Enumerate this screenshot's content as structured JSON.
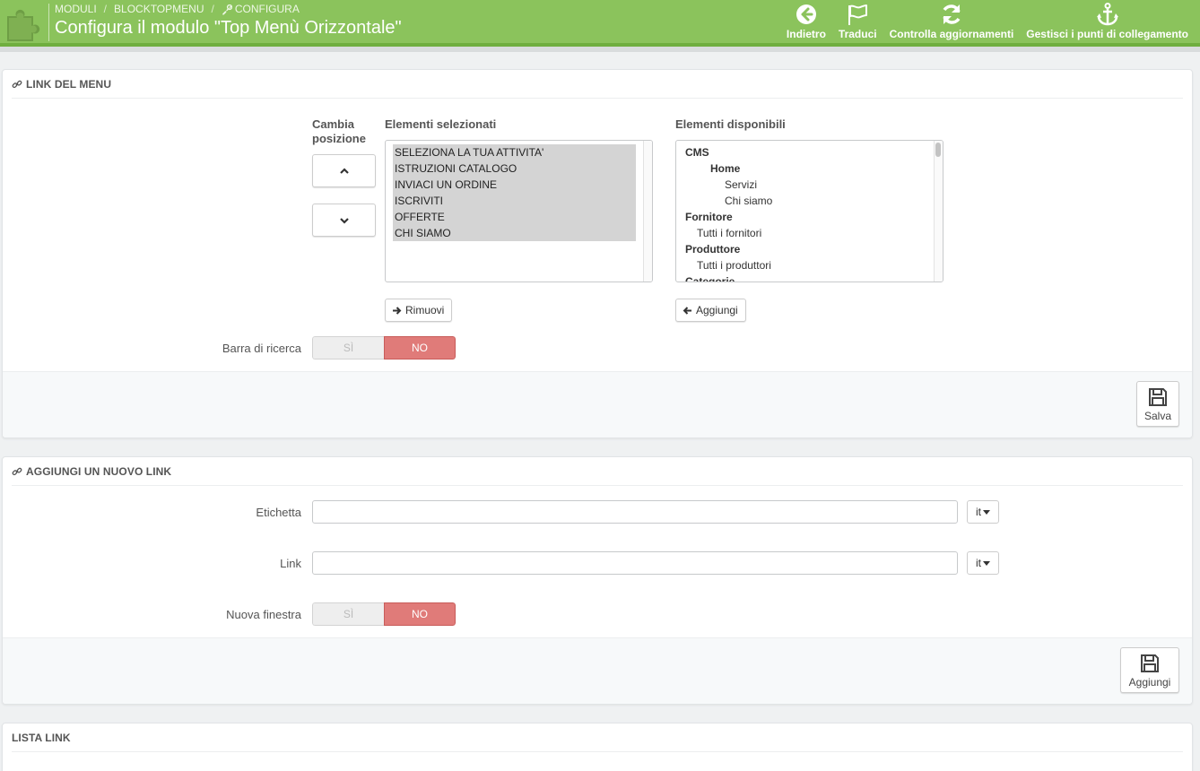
{
  "header": {
    "breadcrumb": [
      "MODULI",
      "BLOCKTOPMENU",
      "CONFIGURA"
    ],
    "title": "Configura il modulo \"Top Menù Orizzontale\"",
    "toolbar": [
      {
        "label": "Indietro",
        "icon": "arrow-circle-left-icon"
      },
      {
        "label": "Traduci",
        "icon": "flag-icon"
      },
      {
        "label": "Controlla aggiornamenti",
        "icon": "refresh-icon"
      },
      {
        "label": "Gestisci i punti di collegamento",
        "icon": "anchor-icon"
      }
    ]
  },
  "menu_links": {
    "heading": "LINK DEL MENU",
    "change_position_label": "Cambia posizione",
    "selected_title": "Elementi selezionati",
    "available_title": "Elementi disponibili",
    "selected_items": [
      "SELEZIONA LA TUA ATTIVITA'",
      "ISTRUZIONI CATALOGO",
      "INVIACI UN ORDINE",
      "ISCRIVITI",
      "OFFERTE",
      "CHI SIAMO"
    ],
    "available_items": [
      {
        "label": "CMS",
        "level": "g"
      },
      {
        "label": "Home",
        "level": "g l2"
      },
      {
        "label": "Servizi",
        "level": "l3"
      },
      {
        "label": "Chi siamo",
        "level": "l3"
      },
      {
        "label": "Fornitore",
        "level": "g"
      },
      {
        "label": "Tutti i fornitori",
        "level": "l1"
      },
      {
        "label": "Produttore",
        "level": "g"
      },
      {
        "label": "Tutti i produttori",
        "level": "l1"
      },
      {
        "label": "Categorie",
        "level": "g"
      }
    ],
    "remove_label": "Rimuovi",
    "add_label": "Aggiungi",
    "search_bar_label": "Barra di ricerca",
    "toggle_yes": "SÌ",
    "toggle_no": "NO",
    "save_label": "Salva"
  },
  "new_link": {
    "heading": "AGGIUNGI UN NUOVO LINK",
    "label_field": "Etichetta",
    "link_field": "Link",
    "lang": "it",
    "new_window_label": "Nuova finestra",
    "toggle_yes": "SÌ",
    "toggle_no": "NO",
    "save_label": "Aggiungi"
  },
  "link_list": {
    "heading": "LISTA LINK"
  },
  "colors": {
    "header_green": "#8bc35c",
    "toggle_no": "#e07b79"
  }
}
